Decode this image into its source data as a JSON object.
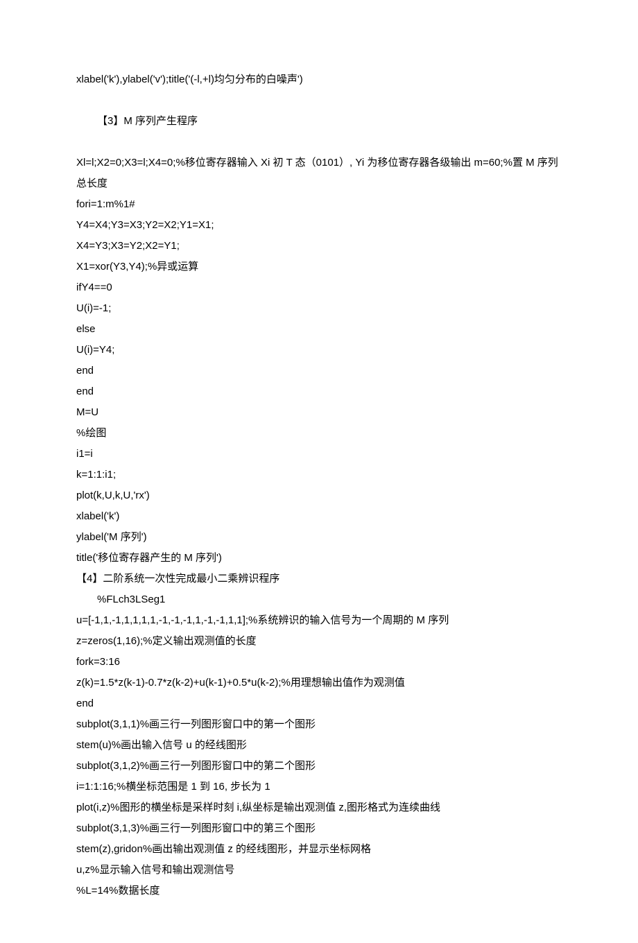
{
  "lines": [
    {
      "cls": "line",
      "key": "l0"
    },
    {
      "cls": "spacer",
      "key": "sp0"
    },
    {
      "cls": "line heading",
      "key": "l1"
    },
    {
      "cls": "spacer",
      "key": "sp1"
    },
    {
      "cls": "line",
      "key": "l2"
    },
    {
      "cls": "line",
      "key": "l3"
    },
    {
      "cls": "line",
      "key": "l4"
    },
    {
      "cls": "line",
      "key": "l5"
    },
    {
      "cls": "line",
      "key": "l6"
    },
    {
      "cls": "line",
      "key": "l7"
    },
    {
      "cls": "line",
      "key": "l8"
    },
    {
      "cls": "line",
      "key": "l9"
    },
    {
      "cls": "line",
      "key": "l10"
    },
    {
      "cls": "line",
      "key": "l11"
    },
    {
      "cls": "line",
      "key": "l12"
    },
    {
      "cls": "line",
      "key": "l13"
    },
    {
      "cls": "line",
      "key": "l14"
    },
    {
      "cls": "line",
      "key": "l15"
    },
    {
      "cls": "line",
      "key": "l16"
    },
    {
      "cls": "line",
      "key": "l17"
    },
    {
      "cls": "line",
      "key": "l18"
    },
    {
      "cls": "line",
      "key": "l19"
    },
    {
      "cls": "line",
      "key": "l20"
    },
    {
      "cls": "line",
      "key": "l21"
    },
    {
      "cls": "spacer",
      "key": "sp2"
    },
    {
      "cls": "line heading",
      "key": "l22"
    },
    {
      "cls": "line",
      "key": "l23"
    },
    {
      "cls": "line",
      "key": "l24"
    },
    {
      "cls": "line",
      "key": "l25"
    },
    {
      "cls": "line",
      "key": "l26"
    },
    {
      "cls": "line",
      "key": "l27"
    },
    {
      "cls": "line",
      "key": "l28"
    },
    {
      "cls": "line",
      "key": "l29"
    },
    {
      "cls": "line",
      "key": "l30"
    },
    {
      "cls": "line",
      "key": "l31"
    },
    {
      "cls": "line",
      "key": "l32"
    },
    {
      "cls": "line",
      "key": "l33"
    },
    {
      "cls": "line",
      "key": "l34"
    },
    {
      "cls": "line",
      "key": "l35"
    },
    {
      "cls": "line",
      "key": "l36"
    },
    {
      "cls": "line",
      "key": "l37"
    }
  ],
  "text": {
    "l0": "xlabel('k'),ylabel('v');title('(-l,+l)均匀分布的白噪声')",
    "l1": "【3】M 序列产生程序",
    "l2": "Xl=l;X2=0;X3=l;X4=0;%移位寄存器输入 Xi 初 T 态（0101）, Yi 为移位寄存器各级输出 m=60;%置 M 序列总长度",
    "l3": "fori=1:m%1#",
    "l4": "Y4=X4;Y3=X3;Y2=X2;Y1=X1;",
    "l5": "X4=Y3;X3=Y2;X2=Y1;",
    "l6": "X1=xor(Y3,Y4);%异或运算",
    "l7": "ifY4==0",
    "l8": "U(i)=-1;",
    "l9": "else",
    "l10": "U(i)=Y4;",
    "l11": "end",
    "l12": "end",
    "l13": "M=U",
    "l14": "%绘图",
    "l15": "i1=i",
    "l16": "k=1:1:i1;",
    "l17": "plot(k,U,k,U,'rx')",
    "l18": "xlabel('k')",
    "l19": "ylabel('M 序列')",
    "l20": "title('移位寄存器产生的 M 序列')",
    "l21": "",
    "l22": "【4】二阶系统一次性完成最小二乘辨识程序",
    "l23": "%FLch3LSeg1",
    "l24": "u=[-1,1,-1,1,1,1,1,-1,-1,-1,1,-1,-1,1,1];%系统辨识的输入信号为一个周期的 M 序列",
    "l25": "z=zeros(1,16);%定义输出观测值的长度",
    "l26": "fork=3:16",
    "l27": "z(k)=1.5*z(k-1)-0.7*z(k-2)+u(k-1)+0.5*u(k-2);%用理想输出值作为观测值",
    "l28": "end",
    "l29": "subplot(3,1,1)%画三行一列图形窗口中的第一个图形",
    "l30": "stem(u)%画出输入信号 u 的经线图形",
    "l31": "subplot(3,1,2)%画三行一列图形窗口中的第二个图形",
    "l32": "i=1:1:16;%横坐标范围是 1 到 16, 步长为 1",
    "l33": "plot(i,z)%图形的横坐标是采样时刻 i,纵坐标是输出观测值 z,图形格式为连续曲线",
    "l34": "subplot(3,1,3)%画三行一列图形窗口中的第三个图形",
    "l35": "stem(z),gridon%画出输出观测值 z 的经线图形，并显示坐标网格",
    "l36": "u,z%显示输入信号和输出观测信号",
    "l37": "%L=14%数据长度"
  }
}
